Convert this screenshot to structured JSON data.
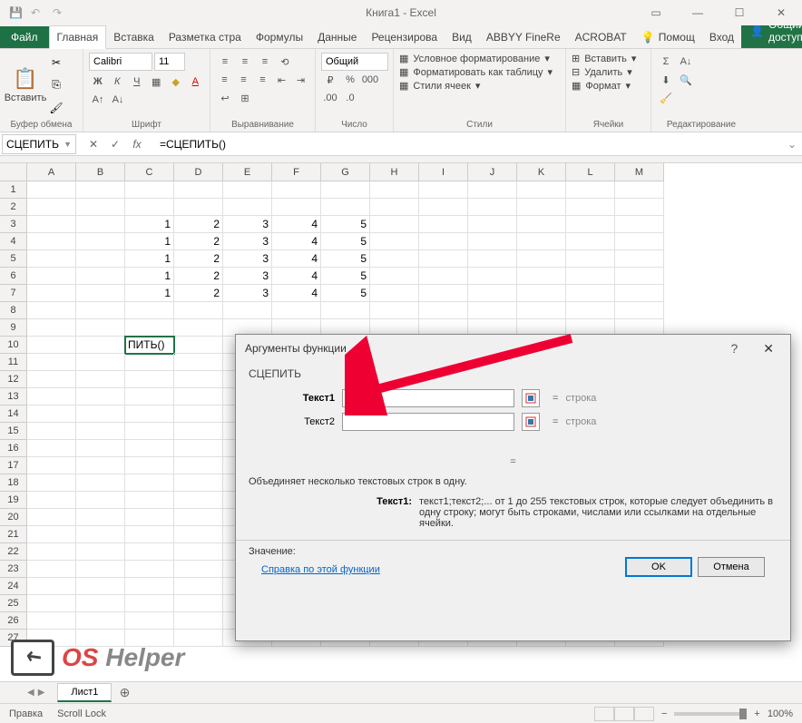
{
  "title": "Книга1 - Excel",
  "tabs": {
    "file": "Файл",
    "home": "Главная",
    "insert": "Вставка",
    "layout": "Разметка стра",
    "formulas": "Формулы",
    "data": "Данные",
    "review": "Рецензирова",
    "view": "Вид",
    "abbyy": "ABBYY FineRe",
    "acrobat": "ACROBAT",
    "help": "Помощ",
    "login": "Вход",
    "share": "Общий доступ"
  },
  "ribbon": {
    "clipboard": {
      "label": "Буфер обмена",
      "paste": "Вставить"
    },
    "font": {
      "label": "Шрифт",
      "name": "Calibri",
      "size": "11"
    },
    "alignment": {
      "label": "Выравнивание"
    },
    "number": {
      "label": "Число",
      "format": "Общий"
    },
    "styles": {
      "label": "Стили",
      "conditional": "Условное форматирование",
      "table": "Форматировать как таблицу",
      "cell": "Стили ячеек"
    },
    "cells": {
      "label": "Ячейки",
      "insert": "Вставить",
      "delete": "Удалить",
      "format": "Формат"
    },
    "editing": {
      "label": "Редактирование"
    }
  },
  "namebox": "СЦЕПИТЬ",
  "formula": "=СЦЕПИТЬ()",
  "columns": [
    "A",
    "B",
    "C",
    "D",
    "E",
    "F",
    "G",
    "H",
    "I",
    "J",
    "K",
    "L",
    "M"
  ],
  "active_cell_display": "ПИТЬ()",
  "grid_data": {
    "3": {
      "C": "1",
      "D": "2",
      "E": "3",
      "F": "4",
      "G": "5"
    },
    "4": {
      "C": "1",
      "D": "2",
      "E": "3",
      "F": "4",
      "G": "5"
    },
    "5": {
      "C": "1",
      "D": "2",
      "E": "3",
      "F": "4",
      "G": "5"
    },
    "6": {
      "C": "1",
      "D": "2",
      "E": "3",
      "F": "4",
      "G": "5"
    },
    "7": {
      "C": "1",
      "D": "2",
      "E": "3",
      "F": "4",
      "G": "5"
    }
  },
  "dialog": {
    "title": "Аргументы функции",
    "func": "СЦЕПИТЬ",
    "args": [
      {
        "name": "Текст1",
        "bold": true,
        "value": "",
        "result": "строка"
      },
      {
        "name": "Текст2",
        "bold": false,
        "value": "",
        "result": "строка"
      }
    ],
    "result_eq": "=",
    "description": "Объединяет несколько текстовых строк в одну.",
    "arg_help_label": "Текст1:",
    "arg_help_text": "текст1;текст2;... от 1 до 255 текстовых строк, которые следует объединить в одну строку; могут быть строками, числами или ссылками на отдельные ячейки.",
    "value_label": "Значение:",
    "help_link": "Справка по этой функции",
    "ok": "OK",
    "cancel": "Отмена"
  },
  "sheet": {
    "name": "Лист1"
  },
  "status": {
    "mode": "Правка",
    "scroll": "Scroll Lock",
    "zoom": "100%"
  },
  "watermark": {
    "os": "OS",
    "helper": "Helper"
  }
}
